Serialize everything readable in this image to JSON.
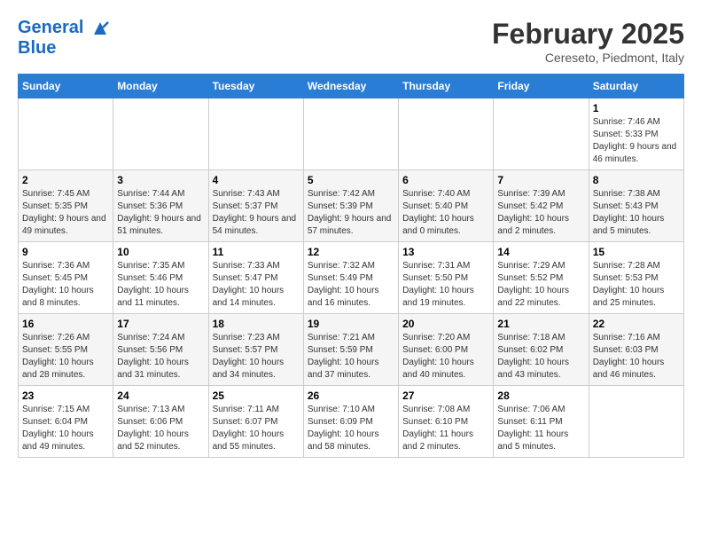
{
  "header": {
    "logo_line1": "General",
    "logo_line2": "Blue",
    "month_title": "February 2025",
    "subtitle": "Cereseto, Piedmont, Italy"
  },
  "days_of_week": [
    "Sunday",
    "Monday",
    "Tuesday",
    "Wednesday",
    "Thursday",
    "Friday",
    "Saturday"
  ],
  "weeks": [
    [
      {
        "day": "",
        "info": ""
      },
      {
        "day": "",
        "info": ""
      },
      {
        "day": "",
        "info": ""
      },
      {
        "day": "",
        "info": ""
      },
      {
        "day": "",
        "info": ""
      },
      {
        "day": "",
        "info": ""
      },
      {
        "day": "1",
        "info": "Sunrise: 7:46 AM\nSunset: 5:33 PM\nDaylight: 9 hours and 46 minutes."
      }
    ],
    [
      {
        "day": "2",
        "info": "Sunrise: 7:45 AM\nSunset: 5:35 PM\nDaylight: 9 hours and 49 minutes."
      },
      {
        "day": "3",
        "info": "Sunrise: 7:44 AM\nSunset: 5:36 PM\nDaylight: 9 hours and 51 minutes."
      },
      {
        "day": "4",
        "info": "Sunrise: 7:43 AM\nSunset: 5:37 PM\nDaylight: 9 hours and 54 minutes."
      },
      {
        "day": "5",
        "info": "Sunrise: 7:42 AM\nSunset: 5:39 PM\nDaylight: 9 hours and 57 minutes."
      },
      {
        "day": "6",
        "info": "Sunrise: 7:40 AM\nSunset: 5:40 PM\nDaylight: 10 hours and 0 minutes."
      },
      {
        "day": "7",
        "info": "Sunrise: 7:39 AM\nSunset: 5:42 PM\nDaylight: 10 hours and 2 minutes."
      },
      {
        "day": "8",
        "info": "Sunrise: 7:38 AM\nSunset: 5:43 PM\nDaylight: 10 hours and 5 minutes."
      }
    ],
    [
      {
        "day": "9",
        "info": "Sunrise: 7:36 AM\nSunset: 5:45 PM\nDaylight: 10 hours and 8 minutes."
      },
      {
        "day": "10",
        "info": "Sunrise: 7:35 AM\nSunset: 5:46 PM\nDaylight: 10 hours and 11 minutes."
      },
      {
        "day": "11",
        "info": "Sunrise: 7:33 AM\nSunset: 5:47 PM\nDaylight: 10 hours and 14 minutes."
      },
      {
        "day": "12",
        "info": "Sunrise: 7:32 AM\nSunset: 5:49 PM\nDaylight: 10 hours and 16 minutes."
      },
      {
        "day": "13",
        "info": "Sunrise: 7:31 AM\nSunset: 5:50 PM\nDaylight: 10 hours and 19 minutes."
      },
      {
        "day": "14",
        "info": "Sunrise: 7:29 AM\nSunset: 5:52 PM\nDaylight: 10 hours and 22 minutes."
      },
      {
        "day": "15",
        "info": "Sunrise: 7:28 AM\nSunset: 5:53 PM\nDaylight: 10 hours and 25 minutes."
      }
    ],
    [
      {
        "day": "16",
        "info": "Sunrise: 7:26 AM\nSunset: 5:55 PM\nDaylight: 10 hours and 28 minutes."
      },
      {
        "day": "17",
        "info": "Sunrise: 7:24 AM\nSunset: 5:56 PM\nDaylight: 10 hours and 31 minutes."
      },
      {
        "day": "18",
        "info": "Sunrise: 7:23 AM\nSunset: 5:57 PM\nDaylight: 10 hours and 34 minutes."
      },
      {
        "day": "19",
        "info": "Sunrise: 7:21 AM\nSunset: 5:59 PM\nDaylight: 10 hours and 37 minutes."
      },
      {
        "day": "20",
        "info": "Sunrise: 7:20 AM\nSunset: 6:00 PM\nDaylight: 10 hours and 40 minutes."
      },
      {
        "day": "21",
        "info": "Sunrise: 7:18 AM\nSunset: 6:02 PM\nDaylight: 10 hours and 43 minutes."
      },
      {
        "day": "22",
        "info": "Sunrise: 7:16 AM\nSunset: 6:03 PM\nDaylight: 10 hours and 46 minutes."
      }
    ],
    [
      {
        "day": "23",
        "info": "Sunrise: 7:15 AM\nSunset: 6:04 PM\nDaylight: 10 hours and 49 minutes."
      },
      {
        "day": "24",
        "info": "Sunrise: 7:13 AM\nSunset: 6:06 PM\nDaylight: 10 hours and 52 minutes."
      },
      {
        "day": "25",
        "info": "Sunrise: 7:11 AM\nSunset: 6:07 PM\nDaylight: 10 hours and 55 minutes."
      },
      {
        "day": "26",
        "info": "Sunrise: 7:10 AM\nSunset: 6:09 PM\nDaylight: 10 hours and 58 minutes."
      },
      {
        "day": "27",
        "info": "Sunrise: 7:08 AM\nSunset: 6:10 PM\nDaylight: 11 hours and 2 minutes."
      },
      {
        "day": "28",
        "info": "Sunrise: 7:06 AM\nSunset: 6:11 PM\nDaylight: 11 hours and 5 minutes."
      },
      {
        "day": "",
        "info": ""
      }
    ]
  ]
}
